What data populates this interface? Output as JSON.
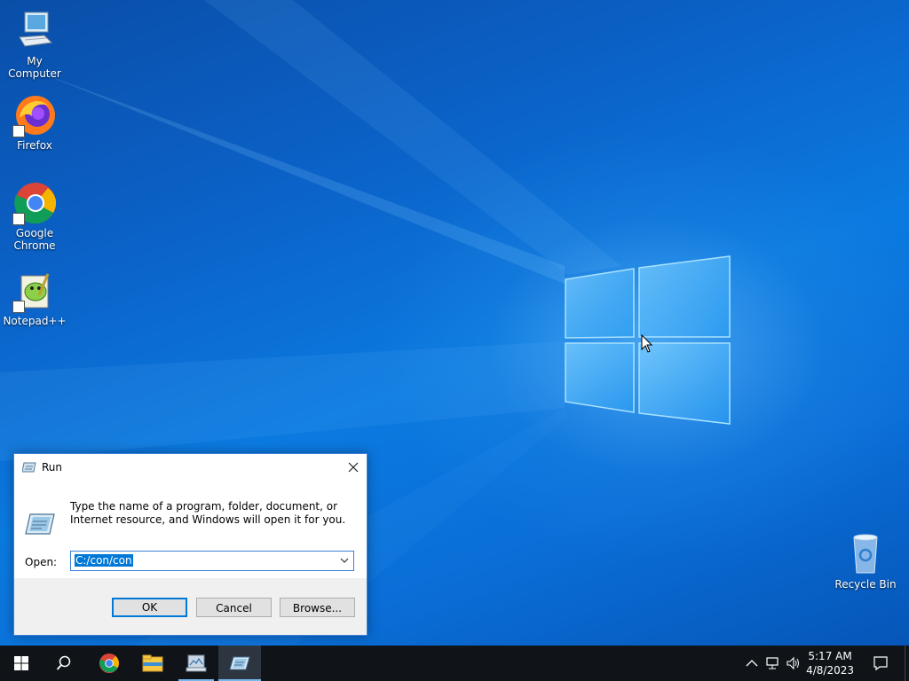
{
  "desktop": {
    "icons": [
      {
        "label": "My Computer"
      },
      {
        "label": "Firefox"
      },
      {
        "label": "Google Chrome"
      },
      {
        "label": "Notepad++"
      },
      {
        "label": "Recycle Bin"
      }
    ]
  },
  "run_dialog": {
    "title": "Run",
    "description": "Type the name of a program, folder, document, or Internet resource, and Windows will open it for you.",
    "open_label": "Open:",
    "input_value": "C:/con/con",
    "ok_label": "OK",
    "cancel_label": "Cancel",
    "browse_label": "Browse..."
  },
  "taskbar": {
    "time": "5:17 AM",
    "date": "4/8/2023"
  },
  "colors": {
    "accent": "#0078d7",
    "taskbar": "#101418",
    "desktop": "#0b6fd6"
  }
}
